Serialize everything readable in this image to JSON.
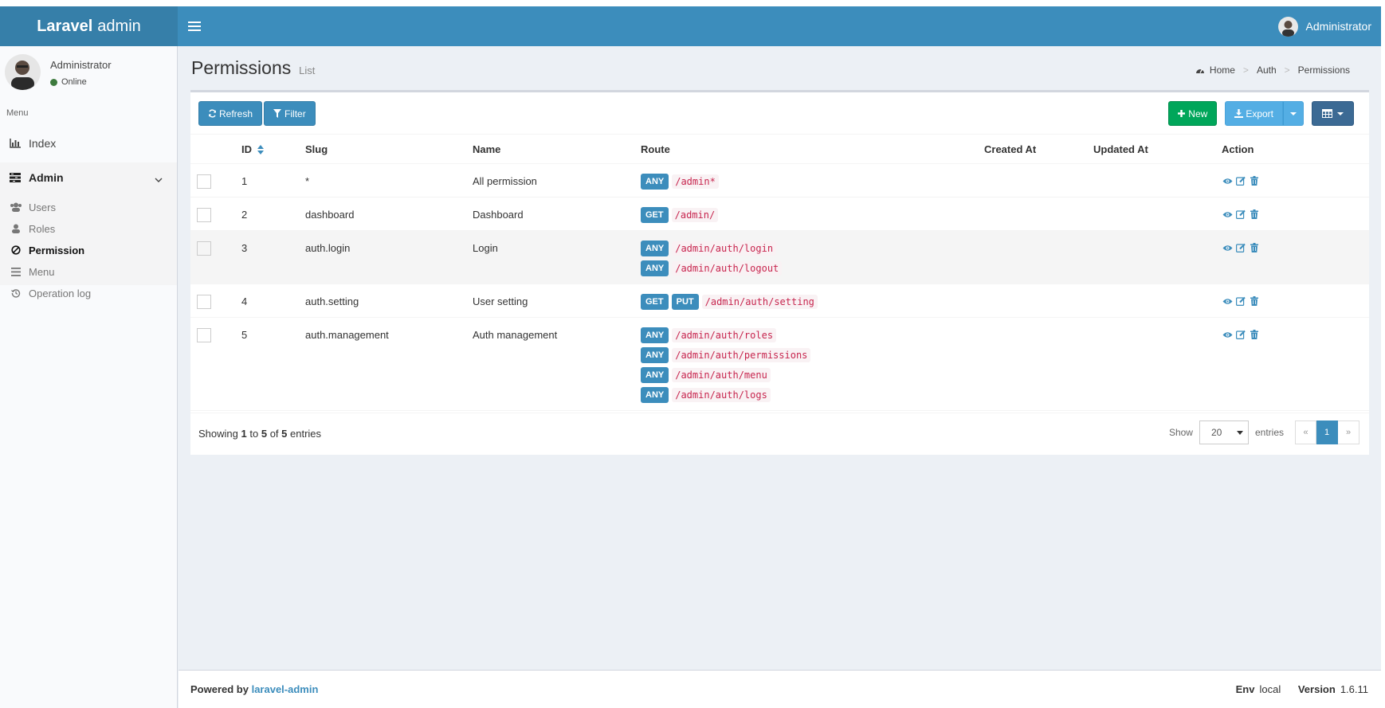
{
  "header": {
    "logo_bold": "Laravel",
    "logo_rest": "admin",
    "user_name": "Administrator"
  },
  "sidebar": {
    "user_name": "Administrator",
    "status": "Online",
    "menu_header": "Menu",
    "index_label": "Index",
    "admin_label": "Admin",
    "sub_items": [
      {
        "label": "Users",
        "icon": "users-icon"
      },
      {
        "label": "Roles",
        "icon": "user-icon"
      },
      {
        "label": "Permission",
        "icon": "ban-icon"
      },
      {
        "label": "Menu",
        "icon": "bars-icon"
      },
      {
        "label": "Operation log",
        "icon": "history-icon"
      }
    ]
  },
  "page": {
    "title": "Permissions",
    "subtitle": "List"
  },
  "breadcrumb": [
    "Home",
    "Auth",
    "Permissions"
  ],
  "toolbar": {
    "refresh": "Refresh",
    "filter": "Filter",
    "new": "New",
    "export": "Export"
  },
  "table": {
    "columns": [
      "ID",
      "Slug",
      "Name",
      "Route",
      "Created At",
      "Updated At",
      "Action"
    ],
    "rows": [
      {
        "id": "1",
        "slug": "*",
        "name": "All permission",
        "routes": [
          {
            "methods": [
              "ANY"
            ],
            "path": "/admin*"
          }
        ]
      },
      {
        "id": "2",
        "slug": "dashboard",
        "name": "Dashboard",
        "routes": [
          {
            "methods": [
              "GET"
            ],
            "path": "/admin/"
          }
        ]
      },
      {
        "id": "3",
        "slug": "auth.login",
        "name": "Login",
        "routes": [
          {
            "methods": [
              "ANY"
            ],
            "path": "/admin/auth/login"
          },
          {
            "methods": [
              "ANY"
            ],
            "path": "/admin/auth/logout"
          }
        ]
      },
      {
        "id": "4",
        "slug": "auth.setting",
        "name": "User setting",
        "routes": [
          {
            "methods": [
              "GET",
              "PUT"
            ],
            "path": "/admin/auth/setting"
          }
        ]
      },
      {
        "id": "5",
        "slug": "auth.management",
        "name": "Auth management",
        "routes": [
          {
            "methods": [
              "ANY"
            ],
            "path": "/admin/auth/roles"
          },
          {
            "methods": [
              "ANY"
            ],
            "path": "/admin/auth/permissions"
          },
          {
            "methods": [
              "ANY"
            ],
            "path": "/admin/auth/menu"
          },
          {
            "methods": [
              "ANY"
            ],
            "path": "/admin/auth/logs"
          }
        ]
      }
    ]
  },
  "pagination": {
    "showing_prefix": "Showing",
    "from": "1",
    "to_word": "to",
    "to": "5",
    "of_word": "of",
    "total": "5",
    "entries_word": "entries",
    "show_label": "Show",
    "per_page": "20",
    "entries_label": "entries",
    "prev": "«",
    "current": "1",
    "next": "»"
  },
  "footer": {
    "powered_by": "Powered by",
    "powered_link": "laravel-admin",
    "env_label": "Env",
    "env_value": "local",
    "version_label": "Version",
    "version_value": "1.6.11"
  },
  "colors": {
    "header": "#3c8dbc",
    "logo_bg": "#367fa9",
    "success": "#00a65a",
    "info": "#54aee4"
  }
}
